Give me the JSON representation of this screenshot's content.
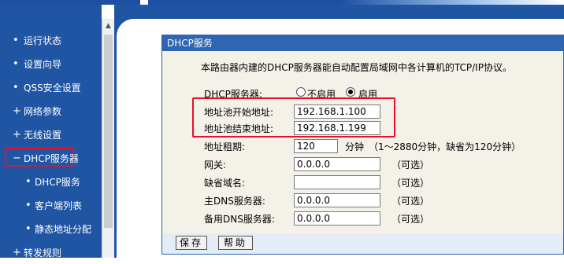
{
  "nav": {
    "items": [
      {
        "bullet": "•",
        "label": "运行状态"
      },
      {
        "bullet": "•",
        "label": "设置向导"
      },
      {
        "bullet": "•",
        "label": "QSS安全设置"
      },
      {
        "bullet": "+",
        "label": "网络参数"
      },
      {
        "bullet": "+",
        "label": "无线设置"
      },
      {
        "bullet": "−",
        "label": "DHCP服务器"
      },
      {
        "bullet": "•",
        "label": "DHCP服务"
      },
      {
        "bullet": "•",
        "label": "客户端列表"
      },
      {
        "bullet": "•",
        "label": "静态地址分配"
      },
      {
        "bullet": "+",
        "label": "转发规则"
      }
    ]
  },
  "panel": {
    "title": "DHCP服务",
    "description": "本路由器内建的DHCP服务器能自动配置局域网中各计算机的TCP/IP协议。",
    "dhcp_server": {
      "label": "DHCP服务器:",
      "option_disable": "不启用",
      "option_enable": "启用",
      "selected": "启用"
    },
    "pool_start": {
      "label": "地址池开始地址:",
      "value": "192.168.1.100"
    },
    "pool_end": {
      "label": "地址池结束地址:",
      "value": "192.168.1.199"
    },
    "lease": {
      "label": "地址租期:",
      "value": "120",
      "unit": "分钟",
      "hint": "（1～2880分钟，缺省为120分钟）"
    },
    "gateway": {
      "label": "网关:",
      "value": "0.0.0.0",
      "hint": "（可选）"
    },
    "domain": {
      "label": "缺省域名:",
      "value": "",
      "hint": "（可选）"
    },
    "dns_primary": {
      "label": "主DNS服务器:",
      "value": "0.0.0.0",
      "hint": "（可选）"
    },
    "dns_secondary": {
      "label": "备用DNS服务器:",
      "value": "0.0.0.0",
      "hint": "（可选）"
    },
    "save_label": "保存",
    "help_label": "帮助"
  },
  "colors": {
    "nav_bg": "#1f55a3",
    "highlight": "#e8102a",
    "panel_head": "#2f66b1",
    "panel_body": "#f3f1e8"
  }
}
